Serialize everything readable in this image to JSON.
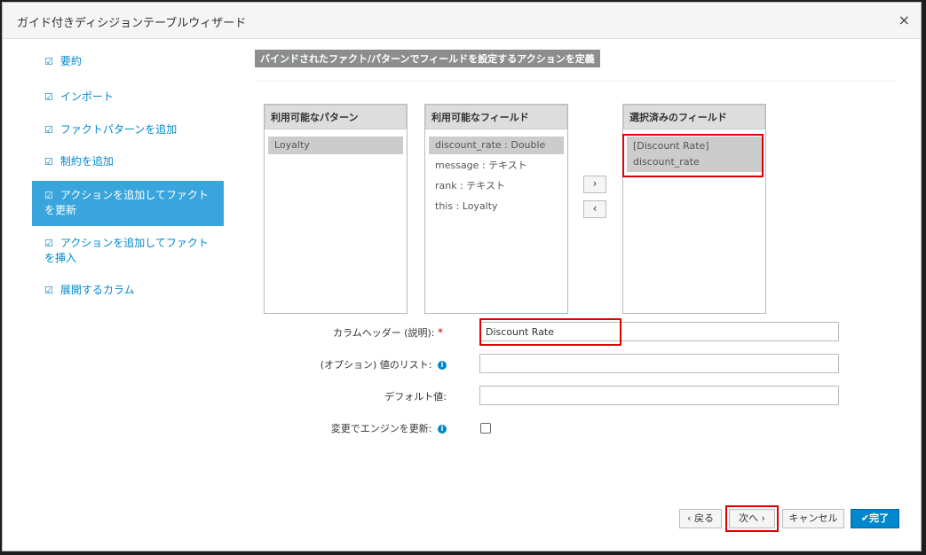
{
  "dialog": {
    "title": "ガイド付きディシジョンテーブルウィザード",
    "close_icon": "×"
  },
  "steps": [
    {
      "label": "要約",
      "check": "☑"
    },
    {
      "label": "インポート",
      "check": "☑"
    },
    {
      "label": "ファクトパターンを追加",
      "check": "☑"
    },
    {
      "label": "制約を追加",
      "check": "☑"
    },
    {
      "label": "アクションを追加してファクトを更新",
      "check": "☑"
    },
    {
      "label": "アクションを追加してファクトを挿入",
      "check": "☑"
    },
    {
      "label": "展開するカラム",
      "check": "☑"
    }
  ],
  "section_title": "バインドされたファクト/パターンでフィールドを設定するアクションを定義",
  "patterns": {
    "header": "利用可能なパターン",
    "items": [
      "Loyalty"
    ]
  },
  "fields": {
    "header": "利用可能なフィールド",
    "items": [
      "discount_rate : Double",
      "message : テキスト",
      "rank : テキスト",
      "this : Loyalty"
    ]
  },
  "selected": {
    "header": "選択済みのフィールド",
    "items": [
      "[Discount Rate]",
      "discount_rate"
    ]
  },
  "arrows": {
    "add": "›",
    "remove": "‹"
  },
  "form": {
    "column_header_label": "カラムヘッダー (説明):",
    "required_mark": "*",
    "column_header_value": "Discount Rate",
    "value_list_label": "(オプション) 値のリスト:",
    "value_list_value": "",
    "default_label": "デフォルト値:",
    "default_value": "",
    "update_engine_label": "変更でエンジンを更新:",
    "info_icon": "i"
  },
  "buttons": {
    "back": "‹ 戻る",
    "next": "次へ ›",
    "cancel": "キャンセル",
    "finish": "✔完了"
  }
}
